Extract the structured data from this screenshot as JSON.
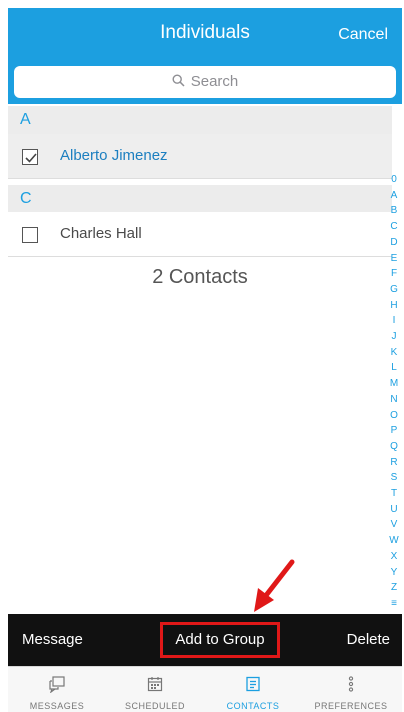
{
  "header": {
    "title": "Individuals",
    "cancel": "Cancel"
  },
  "search": {
    "placeholder": "Search"
  },
  "sections": [
    {
      "letter": "A",
      "contacts": [
        {
          "name": "Alberto Jimenez",
          "checked": true
        }
      ]
    },
    {
      "letter": "C",
      "contacts": [
        {
          "name": "Charles Hall",
          "checked": false
        }
      ]
    }
  ],
  "contacts_count": "2 Contacts",
  "alpha_index": [
    "0",
    "A",
    "B",
    "C",
    "D",
    "E",
    "F",
    "G",
    "H",
    "I",
    "J",
    "K",
    "L",
    "M",
    "N",
    "O",
    "P",
    "Q",
    "R",
    "S",
    "T",
    "U",
    "V",
    "W",
    "X",
    "Y",
    "Z",
    "≡"
  ],
  "actions": {
    "message": "Message",
    "add_to_group": "Add to Group",
    "delete": "Delete"
  },
  "tabs": [
    {
      "label": "MESSAGES",
      "icon": "messages-icon",
      "active": false
    },
    {
      "label": "SCHEDULED",
      "icon": "calendar-icon",
      "active": false
    },
    {
      "label": "CONTACTS",
      "icon": "contacts-icon",
      "active": true
    },
    {
      "label": "PREFERENCES",
      "icon": "more-vertical-icon",
      "active": false
    }
  ],
  "colors": {
    "accent": "#1c9fe0",
    "highlight": "#e01818",
    "action_bar": "#111111"
  }
}
